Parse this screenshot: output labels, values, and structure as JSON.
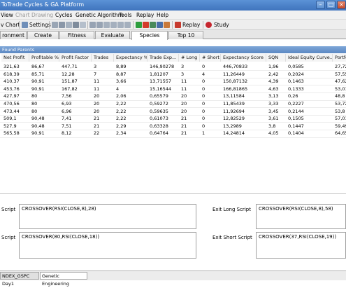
{
  "window": {
    "title": "ToTrade Cycles & GA Platform"
  },
  "menu": [
    {
      "label": "View",
      "disabled": false
    },
    {
      "label": "Chart",
      "disabled": true
    },
    {
      "label": "Drawing",
      "disabled": true
    },
    {
      "label": "Cycles",
      "disabled": false
    },
    {
      "label": "Genetic Algorithm",
      "disabled": false
    },
    {
      "label": "Tools",
      "disabled": false
    },
    {
      "label": "Replay",
      "disabled": false
    },
    {
      "label": "Help",
      "disabled": false
    }
  ],
  "toolbar": {
    "chart_label": "v Chart",
    "settings_label": "Settings",
    "replay_label": "Replay",
    "study_label": "Study"
  },
  "tabs": [
    {
      "label": "ronment",
      "active": false
    },
    {
      "label": "Create",
      "active": false
    },
    {
      "label": "Fitness",
      "active": false
    },
    {
      "label": "Evaluate",
      "active": false
    },
    {
      "label": "Species",
      "active": true
    },
    {
      "label": "Top 10",
      "active": false
    }
  ],
  "section_title": "Found Parents",
  "table": {
    "columns": [
      "Net Profit",
      "Profitable %",
      "Profit Factor",
      "Trades",
      "Expectancy %",
      "Trade Exp...",
      "# Long",
      "# Short",
      "Expectancy Score",
      "SQN",
      "Ideal Equity Curve...",
      "Portfo"
    ],
    "rows": [
      [
        "321,63",
        "86,67",
        "447,71",
        "3",
        "8,89",
        "146,90278",
        "3",
        "0",
        "446,70833",
        "1,96",
        "0,0585",
        "27,72"
      ],
      [
        "618,39",
        "85,71",
        "12,28",
        "7",
        "8,87",
        "1,81207",
        "3",
        "4",
        "11,26449",
        "2,42",
        "0,2024",
        "57,55"
      ],
      [
        "410,37",
        "90,91",
        "151,87",
        "11",
        "3,66",
        "13,71557",
        "11",
        "0",
        "150,87132",
        "4,39",
        "0,1463",
        "47,62"
      ],
      [
        "453,76",
        "90,91",
        "167,82",
        "11",
        "4",
        "15,16544",
        "11",
        "0",
        "166,81865",
        "4,63",
        "0,1333",
        "53,01"
      ],
      [
        "427,97",
        "80",
        "7,56",
        "20",
        "2,06",
        "0,65579",
        "20",
        "0",
        "13,11584",
        "3,13",
        "0,26",
        "48,8"
      ],
      [
        "470,56",
        "80",
        "6,93",
        "20",
        "2,22",
        "0,59272",
        "20",
        "0",
        "11,85439",
        "3,33",
        "0,2227",
        "53,72"
      ],
      [
        "473,44",
        "80",
        "6,96",
        "20",
        "2,22",
        "0,59635",
        "20",
        "0",
        "11,92694",
        "3,45",
        "0,2144",
        "53,8"
      ],
      [
        "509,1",
        "90,48",
        "7,41",
        "21",
        "2,22",
        "0,61073",
        "21",
        "0",
        "12,82529",
        "3,61",
        "0,1505",
        "57,01"
      ],
      [
        "527,9",
        "90,48",
        "7,51",
        "21",
        "2,29",
        "0,63328",
        "21",
        "0",
        "13,2989",
        "3,8",
        "0,1447",
        "59,49"
      ],
      [
        "565,58",
        "90,91",
        "8,12",
        "22",
        "2,34",
        "0,64764",
        "21",
        "1",
        "14,24814",
        "4,05",
        "0,1404",
        "64,65"
      ]
    ]
  },
  "scripts": {
    "entry_long_label": "Script",
    "entry_long_value": "CROSSOVER(RSI(CLOSE,8),28)",
    "entry_short_label": "Script",
    "entry_short_value": "CROSSOVER(80,RSI(CLOSE,18))",
    "exit_long_label": "Exit Long Script",
    "exit_long_value": "CROSSOVER(RSI(CLOSE,8),58)",
    "exit_short_label": "Exit Short Script",
    "exit_short_value": "CROSSOVER(37,RSI(CLOSE,19))"
  },
  "bottom_tabs": [
    {
      "label": "NDEX_GSPC Day1",
      "active": false
    },
    {
      "label": "Genetic Engineering",
      "active": true
    }
  ],
  "colors": {
    "title_bar": "#3f74bd",
    "section_header": "#5c88c2"
  }
}
